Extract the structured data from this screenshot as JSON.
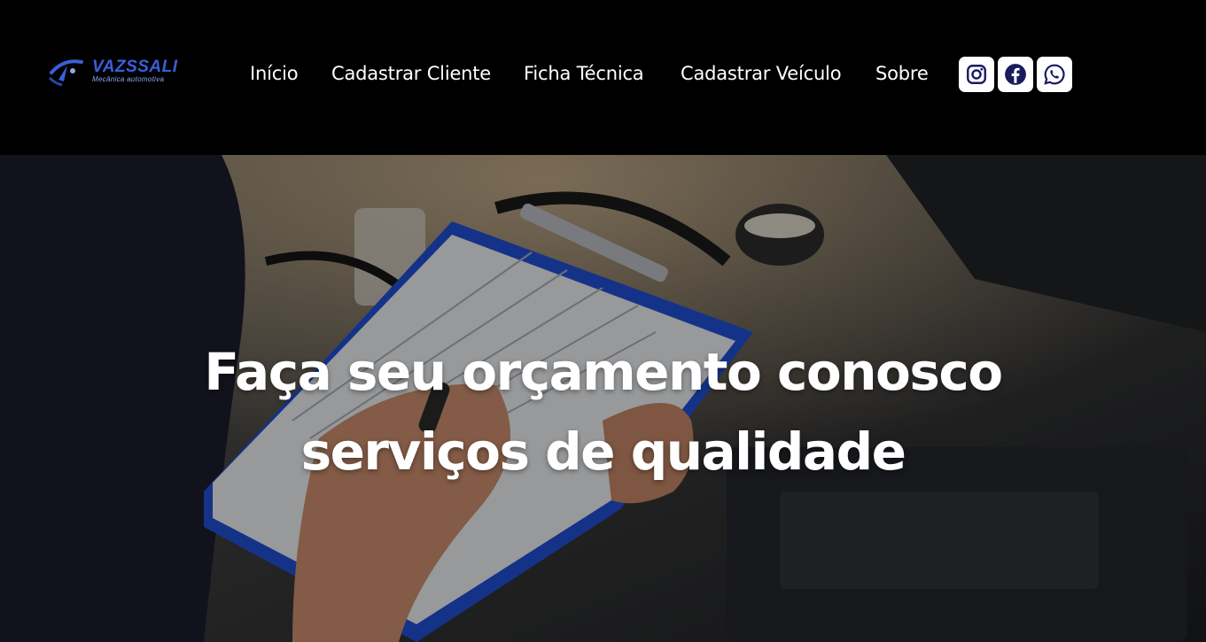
{
  "brand": {
    "name": "VAZSSALI",
    "tagline": "Mecânica automotiva"
  },
  "nav": {
    "items": [
      "Início",
      "Cadastrar Cliente",
      "Ficha Técnica",
      "Cadastrar Veículo",
      "Sobre"
    ]
  },
  "social": [
    {
      "icon": "instagram-icon",
      "color": "#1a1a5e"
    },
    {
      "icon": "facebook-icon",
      "color": "#1a1a5e"
    },
    {
      "icon": "whatsapp-icon",
      "color": "#1a1a5e"
    }
  ],
  "hero": {
    "line1": "Faça seu orçamento conosco",
    "line2": "serviços de qualidade"
  },
  "colors": {
    "header_bg": "#000000",
    "brand_blue": "#3b5fd9",
    "hero_text": "#ffffff"
  }
}
